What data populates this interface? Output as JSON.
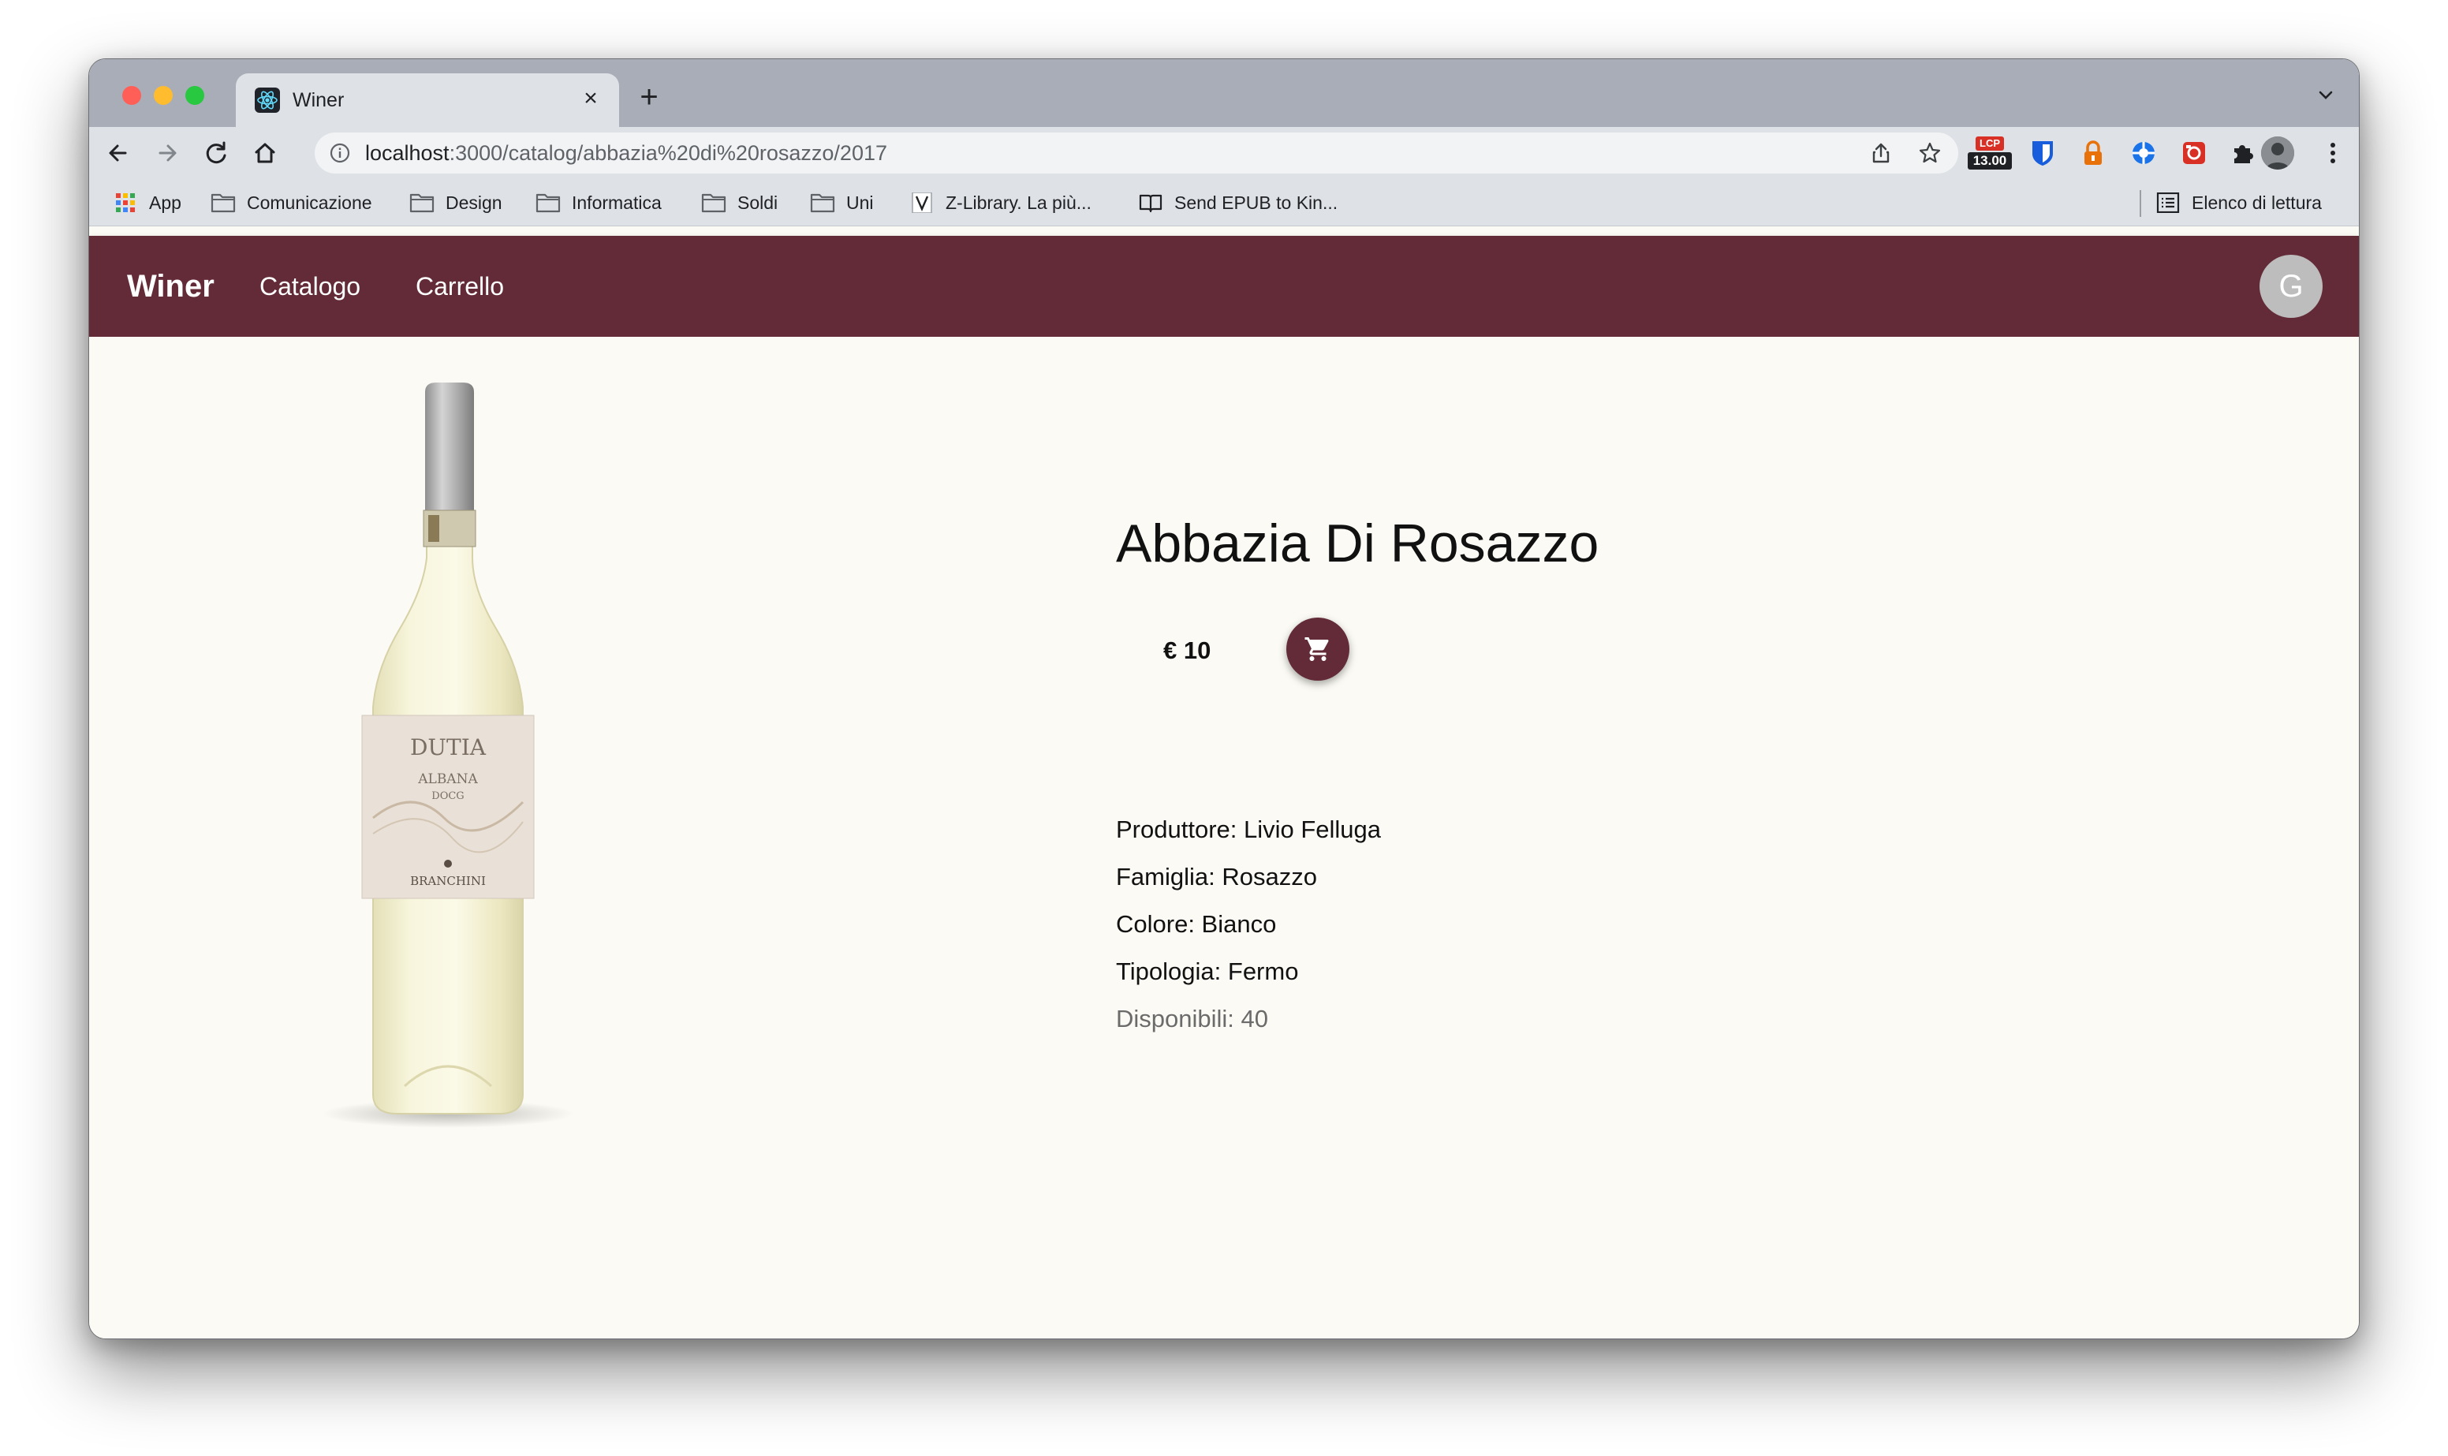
{
  "browser": {
    "tab_title": "Winer",
    "url_host": "localhost",
    "url_path": ":3000/catalog/abbazia%20di%20rosazzo/2017",
    "extension_badge_top": "LCP",
    "extension_badge_bottom": "13.00",
    "bookmarks": [
      {
        "label": "App",
        "icon": "apps-grid-icon"
      },
      {
        "label": "Comunicazione",
        "icon": "folder-icon"
      },
      {
        "label": "Design",
        "icon": "folder-icon"
      },
      {
        "label": "Informatica",
        "icon": "folder-icon"
      },
      {
        "label": "Soldi",
        "icon": "folder-icon"
      },
      {
        "label": "Uni",
        "icon": "folder-icon"
      },
      {
        "label": "Z-Library. La più...",
        "icon": "z-library-icon"
      },
      {
        "label": "Send EPUB to Kin...",
        "icon": "book-icon"
      }
    ],
    "reading_list": "Elenco di lettura"
  },
  "app": {
    "brand": "Winer",
    "nav": [
      "Catalogo",
      "Carrello"
    ],
    "user_initial": "G",
    "accent_color": "#632b37",
    "background_color": "#fbfaf4"
  },
  "product": {
    "title": "Abbazia Di Rosazzo",
    "price": "€ 10",
    "producer": "Produttore: Livio Felluga",
    "family": "Famiglia: Rosazzo",
    "color": "Colore: Bianco",
    "type": "Tipologia: Fermo",
    "available": "Disponibili: 40",
    "label": {
      "name": "DUTIA",
      "line1": "ALBANA",
      "line2": "DOCG",
      "maker": "BRANCHINI"
    }
  }
}
